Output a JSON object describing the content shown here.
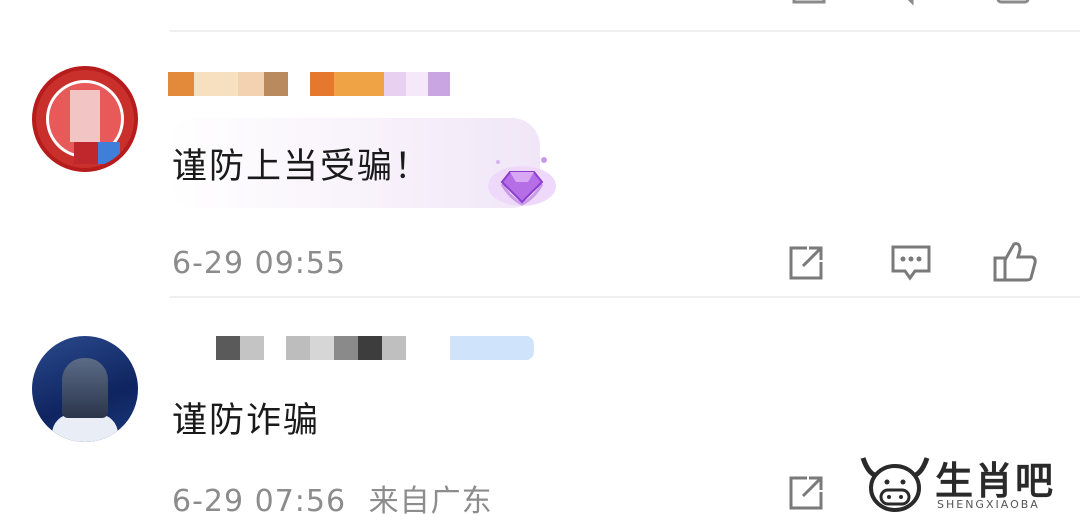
{
  "comments": [
    {
      "avatar": "government-badge-avatar",
      "text": "谨防上当受骗！",
      "badge_icon": "purple-diamond-badge-icon",
      "timestamp": "6-29 09:55",
      "location": ""
    },
    {
      "avatar": "news-anchor-avatar",
      "text": "谨防诈骗",
      "timestamp": "6-29 07:56",
      "location": "来自广东"
    }
  ],
  "actions": {
    "share_icon": "share-icon",
    "reply_icon": "comment-icon",
    "like_icon": "thumbs-up-icon"
  },
  "watermark": {
    "title": "生肖吧",
    "subtitle": "SHENGXIAOBA"
  },
  "colors": {
    "text": "#1a1a1a",
    "meta": "#8c8c8c",
    "icon": "#7a7a7a",
    "badge_purple": "#a25ad8"
  }
}
